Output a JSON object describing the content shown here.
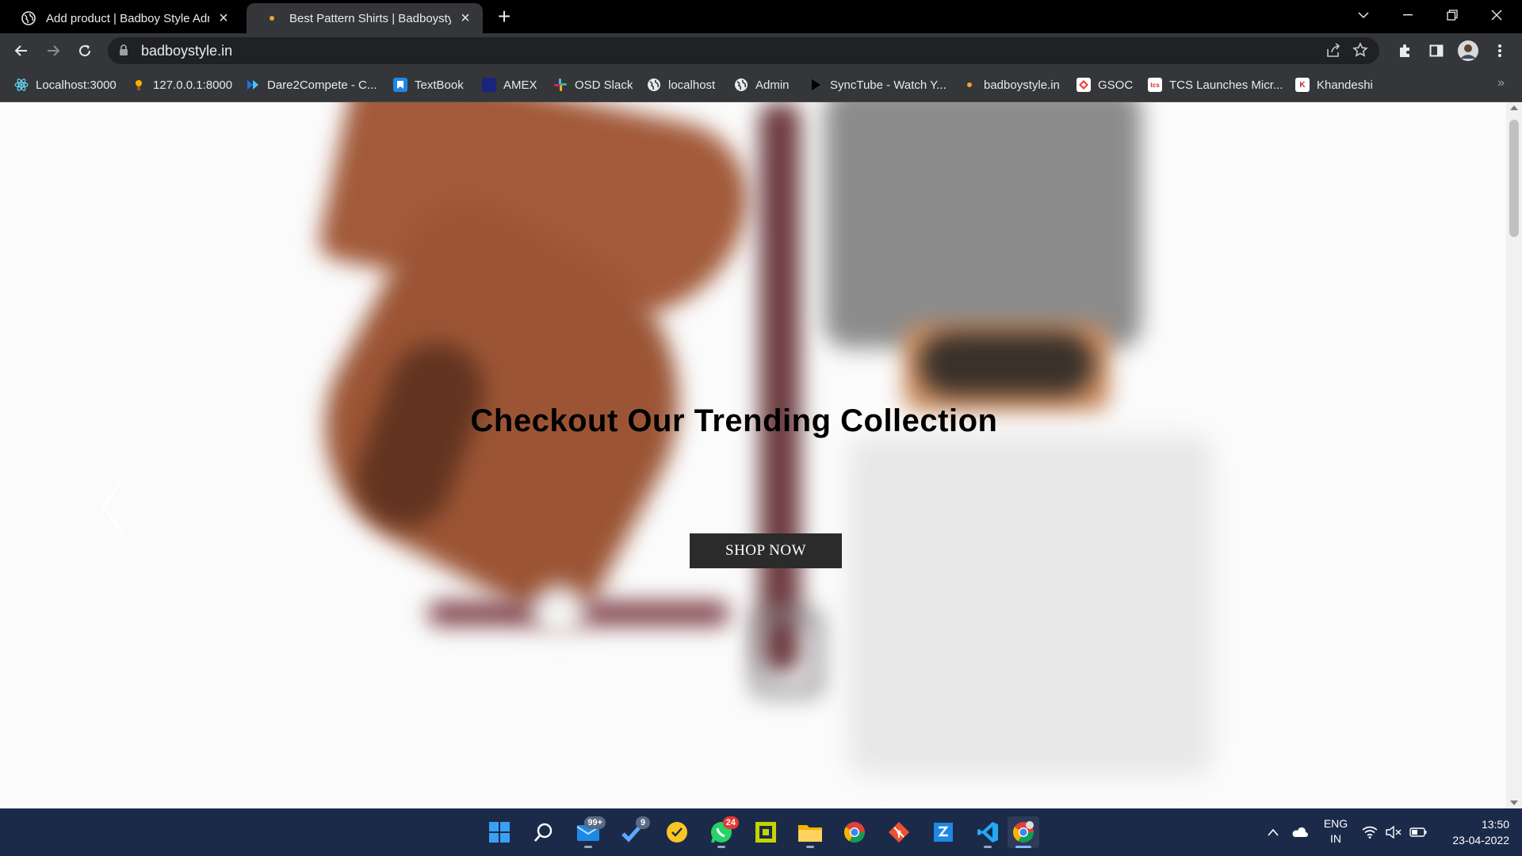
{
  "browser": {
    "tabs": [
      {
        "title": "Add product | Badboy Style Admin",
        "favicon": "globe-icon",
        "active": false
      },
      {
        "title": "Best Pattern Shirts | Badboystyle",
        "favicon": "site-dot-icon",
        "active": true
      }
    ],
    "address": {
      "url": "badboystyle.in"
    },
    "bookmarks": [
      {
        "label": "Localhost:3000",
        "icon": "react-icon",
        "color": "#61dafb"
      },
      {
        "label": "127.0.0.1:8000",
        "icon": "django-icon",
        "color": "#f4b400"
      },
      {
        "label": "Dare2Compete - C...",
        "icon": "d2c-icon",
        "color": "#1a73e8"
      },
      {
        "label": "TextBook",
        "icon": "book-icon",
        "color": "#1e88e5"
      },
      {
        "label": "AMEX",
        "icon": "amex-icon",
        "color": "#1a237e"
      },
      {
        "label": "OSD Slack",
        "icon": "slack-icon",
        "color": "#e01e5a"
      },
      {
        "label": "localhost",
        "icon": "globe-icon",
        "color": "#e8eaed"
      },
      {
        "label": "Admin",
        "icon": "globe-icon",
        "color": "#e8eaed"
      },
      {
        "label": "SyncTube - Watch Y...",
        "icon": "play-icon",
        "color": "#000000"
      },
      {
        "label": "badboystyle.in",
        "icon": "site-dot-icon",
        "color": "#f0a030"
      },
      {
        "label": "GSOC",
        "icon": "gsoc-icon",
        "color": "#ffffff"
      },
      {
        "label": "TCS Launches Micr...",
        "icon": "tcs-icon",
        "color": "#ffffff"
      },
      {
        "label": "Khandeshi",
        "icon": "k-icon",
        "color": "#ffffff"
      }
    ]
  },
  "hero": {
    "heading": "Checkout Our Trending Collection",
    "cta_label": "SHOP NOW"
  },
  "taskbar": {
    "apps": [
      {
        "name": "start-icon"
      },
      {
        "name": "search-icon"
      },
      {
        "name": "mail-icon",
        "badge": "99+"
      },
      {
        "name": "todo-icon",
        "badge": "9"
      },
      {
        "name": "notes-icon"
      },
      {
        "name": "whatsapp-icon",
        "badge": "24"
      },
      {
        "name": "app-grid-icon"
      },
      {
        "name": "folder-icon"
      },
      {
        "name": "chrome-icon"
      },
      {
        "name": "git-icon"
      },
      {
        "name": "editor-icon"
      },
      {
        "name": "vscode-icon"
      },
      {
        "name": "chrome-profile-icon"
      }
    ],
    "language": {
      "line1": "ENG",
      "line2": "IN"
    },
    "clock": {
      "time": "13:50",
      "date": "23-04-2022"
    }
  }
}
